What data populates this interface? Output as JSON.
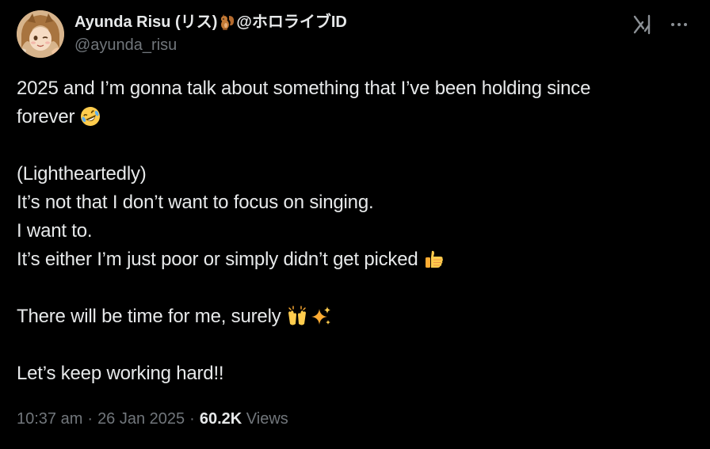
{
  "author": {
    "display_name_prefix": "Ayunda Risu (リス)",
    "display_name_emoji": "squirrel-emoji",
    "display_name_suffix": "@ホロライブID",
    "handle": "@ayunda_risu"
  },
  "icons": {
    "grok": "grok-icon",
    "more": "more-icon"
  },
  "body": {
    "line1": "2025 and I’m gonna talk about something that I’ve been holding since",
    "line2": "forever",
    "line2_emoji": "rolling-on-floor-laughing-emoji",
    "line3": "(Lightheartedly)",
    "line4": "It’s not that I don’t want to focus on singing.",
    "line5": "I want to.",
    "line6": "It’s either I’m just poor or simply didn’t get picked",
    "line6_emoji": "thumbs-up-emoji",
    "line7": "There will be time for me, surely",
    "line7_emojis": [
      "raising-hands-emoji",
      "sparkles-emoji"
    ],
    "line8": "Let’s keep working hard!!"
  },
  "meta": {
    "time": "10:37 am",
    "separator": "·",
    "date": "26 Jan 2025",
    "views_count": "60.2K",
    "views_label": "Views"
  },
  "colors": {
    "background": "#000000",
    "text_primary": "#e7e9ea",
    "text_secondary": "#71767b"
  }
}
